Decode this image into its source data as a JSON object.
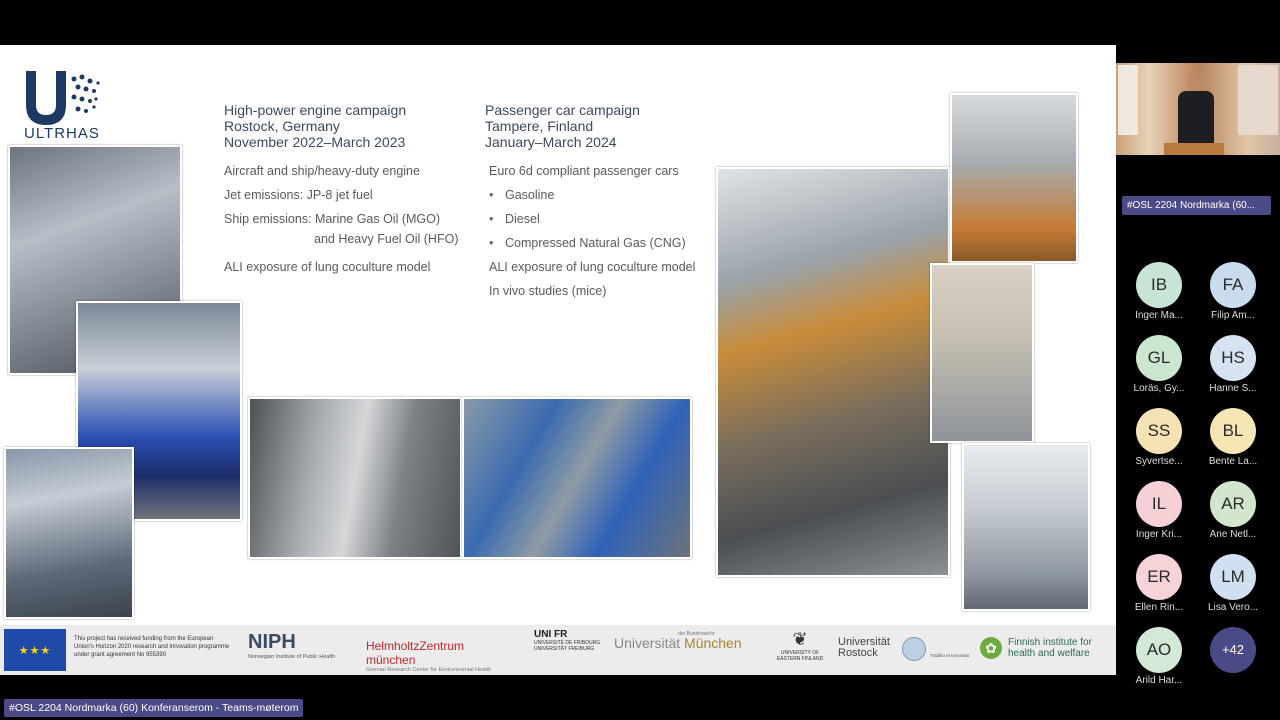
{
  "slide": {
    "logo_text": "ULTRHAS",
    "col1": {
      "heading": [
        "High-power engine campaign",
        "Rostock, Germany",
        "November 2022–March 2023"
      ],
      "line1": "Aircraft and ship/heavy-duty engine",
      "line2": "Jet emissions:  JP-8 jet fuel",
      "line3": "Ship emissions: Marine Gas Oil (MGO)",
      "line3b": "and Heavy Fuel Oil (HFO)",
      "line4": "ALI exposure of lung coculture model"
    },
    "col2": {
      "heading": [
        "Passenger car campaign",
        "Tampere, Finland",
        "January–March 2024"
      ],
      "line1": "Euro 6d compliant passenger cars",
      "bullets": [
        "Gasoline",
        "Diesel",
        "Compressed Natural Gas (CNG)"
      ],
      "line2": "ALI exposure of lung coculture model",
      "line3": "In vivo studies (mice)"
    }
  },
  "logos": {
    "eu_flag": "★★★",
    "eu_text": "This project has received funding from the European Union's Horizon 2020 research and innovation programme under grant agreement No 955390",
    "niph_big": "NIPH",
    "niph_small": "Norwegian Institute of Public Health",
    "helm_big": "HelmholtzZentrum münchen",
    "helm_small": "German Research Center for Environmental Health",
    "unifr_big": "UNI FR",
    "unifr_small": "UNIVERSITÉ DE FRIBOURG UNIVERSITÄT FREIBURG",
    "bund_small": "der Bundeswehr",
    "bund_a": "Universität",
    "bund_b": "München",
    "uef_icon": "❦",
    "uef_small": "UNIVERSITY OF EASTERN FINLAND",
    "rost_big": "Universität Rostock",
    "rost_small": "Traditio et Innovatio",
    "thl_icon": "✿",
    "thl_big": "Finnish institute for health and welfare"
  },
  "teams": {
    "room_label": "#OSL 2204 Nordmarka (60...",
    "participants": [
      {
        "initials": "IB",
        "name": "Inger Ma...",
        "color": "#c7e4d4"
      },
      {
        "initials": "FA",
        "name": "Filip Am...",
        "color": "#c9dcef"
      },
      {
        "initials": "GL",
        "name": "Loräs, Gy...",
        "color": "#cbe6cf"
      },
      {
        "initials": "HS",
        "name": "Hanne S...",
        "color": "#d6e3f1"
      },
      {
        "initials": "SS",
        "name": "Syvertse...",
        "color": "#f4e2b4"
      },
      {
        "initials": "BL",
        "name": "Bente La...",
        "color": "#f6e6b3"
      },
      {
        "initials": "IL",
        "name": "Inger Kri...",
        "color": "#f5d1d6"
      },
      {
        "initials": "AR",
        "name": "Ane Netl...",
        "color": "#d2e6cd"
      },
      {
        "initials": "ER",
        "name": "Ellen Rin...",
        "color": "#f5d3d6"
      },
      {
        "initials": "LM",
        "name": "Lisa Vero...",
        "color": "#d0e0f1"
      },
      {
        "initials": "AO",
        "name": "Arild Har...",
        "color": "#d1e9d6"
      }
    ],
    "more_count": "+42",
    "bottom_label": "#OSL 2204 Nordmarka (60) Konferanserom - Teams-møterom"
  }
}
